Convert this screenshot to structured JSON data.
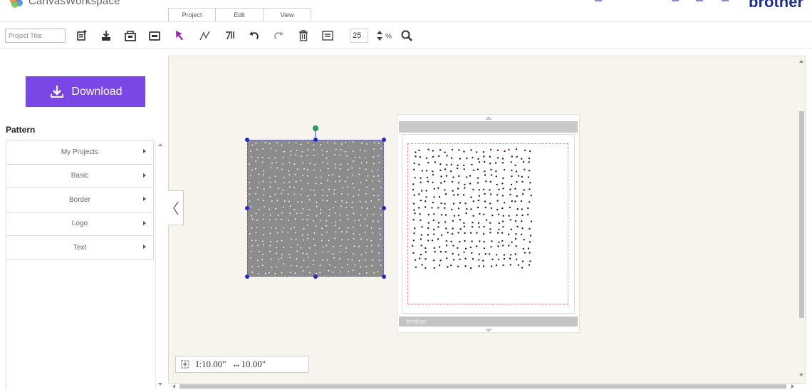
{
  "app": {
    "title": "CanvasWorkspace",
    "brand": "brother"
  },
  "menu": {
    "tabs": [
      {
        "label": "Project"
      },
      {
        "label": "Edit"
      },
      {
        "label": "View"
      }
    ]
  },
  "toolbar": {
    "project_title_placeholder": "Project Title",
    "tools": [
      {
        "icon": "new-project-icon"
      },
      {
        "icon": "import-icon"
      },
      {
        "icon": "open-icon"
      },
      {
        "icon": "save-icon"
      },
      {
        "icon": "select-pointer-icon"
      },
      {
        "icon": "node-edit-icon"
      },
      {
        "icon": "pen-tool-icon"
      },
      {
        "icon": "undo-icon"
      },
      {
        "icon": "redo-icon"
      },
      {
        "icon": "delete-icon"
      },
      {
        "icon": "properties-icon"
      },
      {
        "icon": "zoom-icon"
      }
    ],
    "zoom_value": "25",
    "zoom_unit": "%"
  },
  "left_panel": {
    "download_label": "Download",
    "pattern_title": "Pattern",
    "pattern_items": [
      {
        "label": "My Projects"
      },
      {
        "label": "Basic"
      },
      {
        "label": "Border"
      },
      {
        "label": "Logo"
      },
      {
        "label": "Text"
      }
    ]
  },
  "canvas": {
    "size_readout": {
      "height": "I:10.00\"",
      "width": "↔10.00\""
    },
    "mat_brand": "brother"
  },
  "colors": {
    "accent": "#7b46e6",
    "brand": "#1f2f8f",
    "canvas_bg": "#f6f4ed",
    "shape_fill": "#8c8c8c",
    "selection": "#2428c8"
  }
}
